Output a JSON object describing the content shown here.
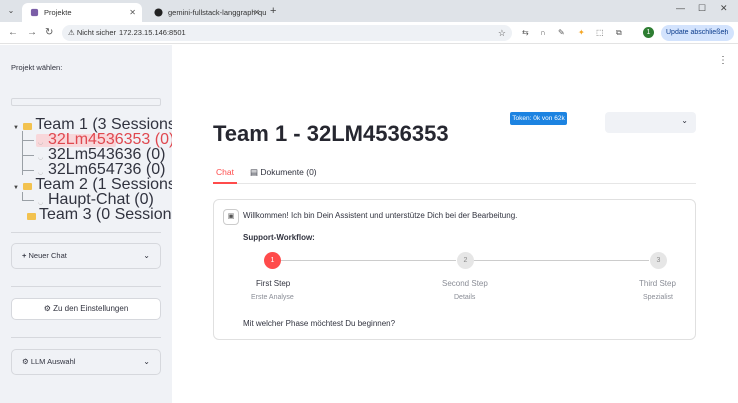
{
  "browser": {
    "tabs": [
      {
        "title": "Projekte",
        "active": true
      },
      {
        "title": "gemini-fullstack-langgraph-qu",
        "active": false
      }
    ],
    "security_label": "Nicht sicher",
    "url": "172.23.15.146:8501",
    "update_label": "Update abschließen",
    "avatar_letter": "1"
  },
  "sidebar": {
    "project_label": "Projekt wählen:",
    "tree": [
      {
        "kind": "team",
        "label": "Team 1 (3 Sessions) ✓"
      },
      {
        "kind": "session",
        "label": "32Lm4536353 (0)",
        "selected": true,
        "marker": "●"
      },
      {
        "kind": "session",
        "label": "32Lm543636 (0)"
      },
      {
        "kind": "session",
        "label": "32Lm654736 (0)"
      },
      {
        "kind": "team",
        "label": "Team 2 (1 Sessions)"
      },
      {
        "kind": "session",
        "label": "Haupt-Chat (0)"
      },
      {
        "kind": "team",
        "label": "Team 3 (0 Sessions)"
      }
    ],
    "new_chat_label": "Neuer Chat",
    "settings_label": "Zu den Einstellungen",
    "llm_label": "LLM Auswahl"
  },
  "main": {
    "token_badge": "Token: 0k von 62k",
    "title": "Team 1 - 32LM4536353",
    "tabs": [
      {
        "label": "Chat",
        "active": true
      },
      {
        "label": "Dokumente (0)",
        "active": false
      }
    ],
    "chat": {
      "welcome": "Willkommen! Ich bin Dein Assistent und unterstütze Dich bei der Bearbeitung.",
      "workflow_title": "Support-Workflow:",
      "steps": [
        {
          "number": "1",
          "name": "First Step",
          "sub": "Erste Analyse",
          "active": true
        },
        {
          "number": "2",
          "name": "Second Step",
          "sub": "Details",
          "active": false
        },
        {
          "number": "3",
          "name": "Third Step",
          "sub": "Spezialist",
          "active": false
        }
      ],
      "question": "Mit welcher Phase möchtest Du beginnen?"
    }
  },
  "colors": {
    "accent": "#ff4b4b",
    "token_badge": "#1c83e1",
    "sidebar_bg": "#f0f2f6"
  }
}
